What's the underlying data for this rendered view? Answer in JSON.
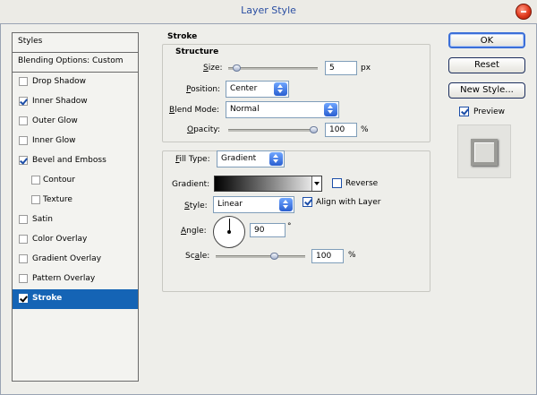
{
  "window": {
    "title": "Layer Style"
  },
  "sidebar": {
    "header": "Styles",
    "blending": "Blending Options: Custom",
    "items": [
      {
        "label": "Drop Shadow",
        "checked": false,
        "indent": false,
        "selected": false
      },
      {
        "label": "Inner Shadow",
        "checked": true,
        "indent": false,
        "selected": false
      },
      {
        "label": "Outer Glow",
        "checked": false,
        "indent": false,
        "selected": false
      },
      {
        "label": "Inner Glow",
        "checked": false,
        "indent": false,
        "selected": false
      },
      {
        "label": "Bevel and Emboss",
        "checked": true,
        "indent": false,
        "selected": false
      },
      {
        "label": "Contour",
        "checked": false,
        "indent": true,
        "selected": false
      },
      {
        "label": "Texture",
        "checked": false,
        "indent": true,
        "selected": false
      },
      {
        "label": "Satin",
        "checked": false,
        "indent": false,
        "selected": false
      },
      {
        "label": "Color Overlay",
        "checked": false,
        "indent": false,
        "selected": false
      },
      {
        "label": "Gradient Overlay",
        "checked": false,
        "indent": false,
        "selected": false
      },
      {
        "label": "Pattern Overlay",
        "checked": false,
        "indent": false,
        "selected": false
      },
      {
        "label": "Stroke",
        "checked": true,
        "indent": false,
        "selected": true
      }
    ]
  },
  "stroke": {
    "title": "Stroke",
    "structure": {
      "title": "Structure",
      "size_label": "Size:",
      "size_value": "5",
      "size_unit": "px",
      "size_level": 0.05,
      "position_label": "Position:",
      "position_value": "Center",
      "blend_label": "Blend Mode:",
      "blend_value": "Normal",
      "opacity_label": "Opacity:",
      "opacity_value": "100",
      "opacity_unit": "%",
      "opacity_level": 1.0
    },
    "fill": {
      "fill_type_label": "Fill Type:",
      "fill_type_value": "Gradient",
      "gradient_label": "Gradient:",
      "reverse_label": "Reverse",
      "reverse_checked": false,
      "style_label": "Style:",
      "style_value": "Linear",
      "align_label": "Align with Layer",
      "align_checked": true,
      "angle_label": "Angle:",
      "angle_value": "90",
      "angle_unit": "°",
      "scale_label": "Scale:",
      "scale_value": "100",
      "scale_unit": "%",
      "scale_level": 0.67
    }
  },
  "buttons": {
    "ok": "OK",
    "reset": "Reset",
    "new_style": "New Style...",
    "preview_label": "Preview",
    "preview_checked": true
  },
  "colors": {
    "selection": "#1564b5",
    "accent": "#2a5fd0",
    "title_text": "#2a4ea2"
  }
}
